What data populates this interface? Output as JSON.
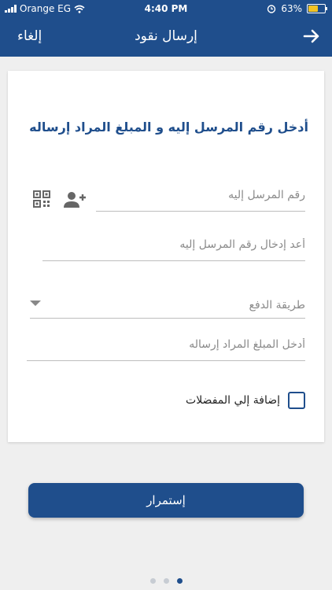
{
  "status_bar": {
    "carrier": "Orange EG",
    "time": "4:40 PM",
    "battery_percent": "63%",
    "battery_level": 0.63,
    "icons": [
      "signal-icon",
      "wifi-icon",
      "alarm-icon",
      "battery-icon"
    ]
  },
  "header": {
    "title": "إرسال نقود",
    "cancel_label": "إلغاء",
    "back_icon": "arrow-right-icon"
  },
  "form": {
    "heading": "أدخل رقم المرسل إليه و المبلغ المراد إرساله",
    "recipient_number_placeholder": "رقم المرسل إليه",
    "confirm_number_placeholder": "أعد إدخال رقم المرسل إليه",
    "payment_method_label": "طريقة الدفع",
    "amount_placeholder": "أدخل المبلغ المراد إرساله",
    "favorite_label": "إضافة إلي المفضلات",
    "favorite_checked": false
  },
  "actions": {
    "continue_label": "إستمرار"
  },
  "pagination": {
    "total": 3,
    "current": 3
  },
  "colors": {
    "brand": "#1f4e8c",
    "battery": "#f3c323",
    "background": "#efefef"
  }
}
